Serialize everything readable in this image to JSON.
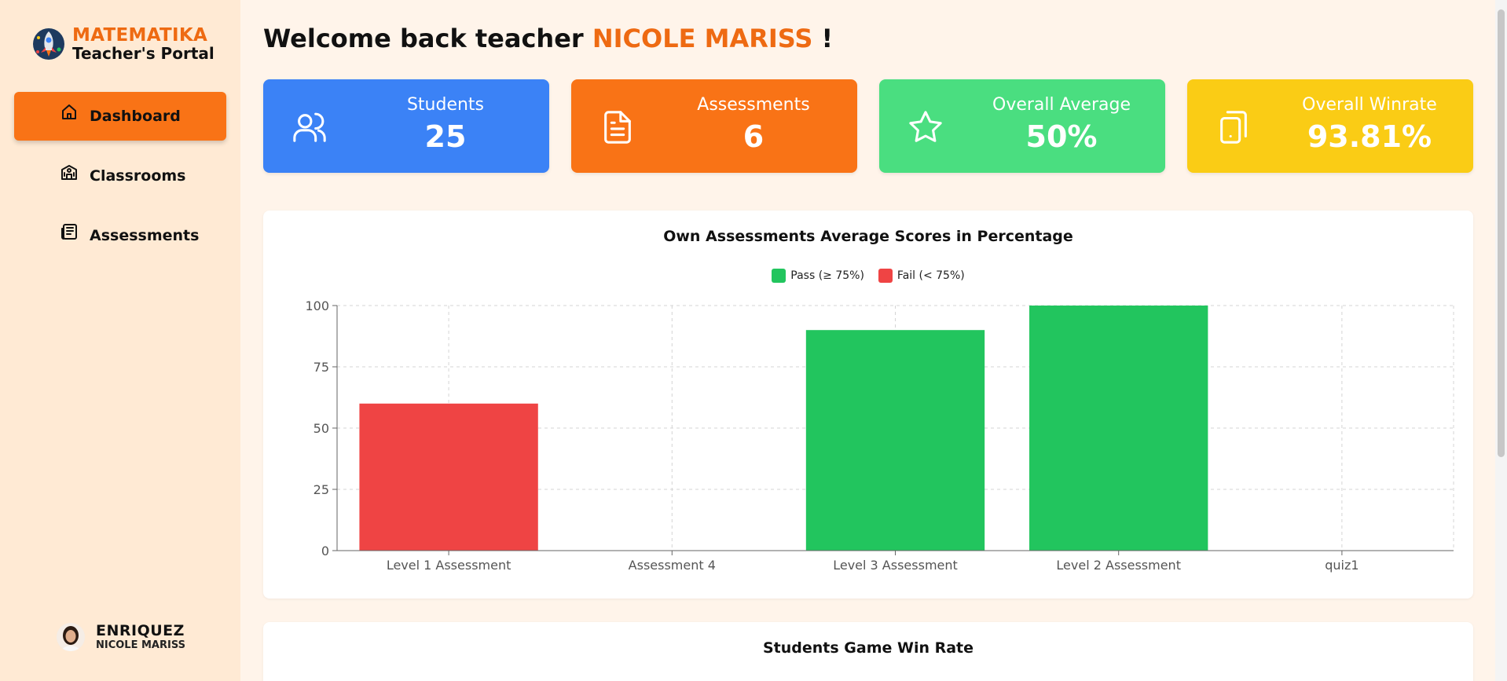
{
  "brand": {
    "title": "MATEMATIKA",
    "subtitle": "Teacher's Portal"
  },
  "nav": [
    {
      "label": "Dashboard",
      "icon": "home-icon",
      "active": true
    },
    {
      "label": "Classrooms",
      "icon": "school-icon",
      "active": false
    },
    {
      "label": "Assessments",
      "icon": "newspaper-icon",
      "active": false
    }
  ],
  "user": {
    "last_name": "ENRIQUEZ",
    "first_name": "NICOLE MARISS"
  },
  "welcome": {
    "prefix": "Welcome back teacher",
    "name": "NICOLE MARISS",
    "suffix": "!"
  },
  "stats": [
    {
      "label": "Students",
      "value": "25",
      "icon": "users-icon",
      "color": "#3b82f6"
    },
    {
      "label": "Assessments",
      "value": "6",
      "icon": "document-icon",
      "color": "#f97316"
    },
    {
      "label": "Overall Average",
      "value": "50%",
      "icon": "star-icon",
      "color": "#4ade80"
    },
    {
      "label": "Overall Winrate",
      "value": "93.81%",
      "icon": "tablet-icon",
      "color": "#facc15"
    }
  ],
  "chart_data": {
    "type": "bar",
    "title": "Own Assessments Average Scores in Percentage",
    "categories": [
      "Level 1 Assessment",
      "Assessment 4",
      "Level 3 Assessment",
      "Level 2 Assessment",
      "quiz1"
    ],
    "values": [
      60,
      0,
      90,
      100,
      0
    ],
    "ylim": [
      0,
      100
    ],
    "yticks": [
      0,
      25,
      50,
      75,
      100
    ],
    "grid": true,
    "legend": [
      {
        "label": "Pass (≥ 75%)",
        "color": "#22c55e"
      },
      {
        "label": "Fail (< 75%)",
        "color": "#ef4444"
      }
    ],
    "threshold": 75,
    "pass_color": "#22c55e",
    "fail_color": "#ef4444"
  },
  "second_panel": {
    "title": "Students Game Win Rate"
  }
}
